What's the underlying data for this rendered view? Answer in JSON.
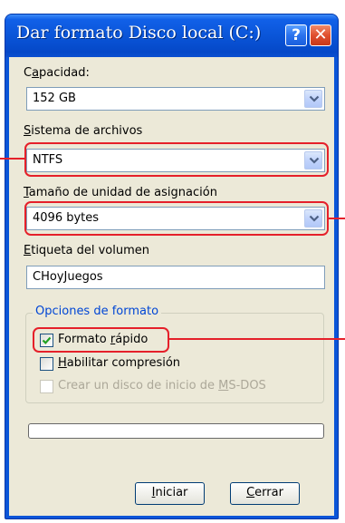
{
  "window": {
    "title": "Dar formato Disco local (C:)",
    "help_glyph": "?",
    "close_glyph": "✕"
  },
  "capacity": {
    "label_prefix": "C",
    "label_underlined": "a",
    "label_suffix": "pacidad:",
    "value": "152 GB"
  },
  "filesystem": {
    "label_underlined": "S",
    "label_suffix": "istema de archivos",
    "value": "NTFS"
  },
  "allocation": {
    "label_underlined": "T",
    "label_suffix": "amaño de unidad de asignación",
    "value": "4096 bytes"
  },
  "volume_label": {
    "label_underlined": "E",
    "label_suffix": "tiqueta del volumen",
    "value": "CHoyJuegos"
  },
  "format_options": {
    "legend_underlined": "O",
    "legend_suffix": "pciones de formato",
    "quick_format": {
      "label_prefix": "Formato ",
      "label_underlined": "r",
      "label_suffix": "ápido",
      "checked": true
    },
    "compression": {
      "label_underlined": "H",
      "label_suffix": "abilitar compresión",
      "checked": false
    },
    "msdos_disk": {
      "label_prefix": "Crear un disco de inicio de ",
      "label_underlined": "M",
      "label_suffix": "S-DOS",
      "checked": false,
      "disabled": true
    }
  },
  "progress": {
    "value": 0
  },
  "buttons": {
    "start": {
      "label_underlined": "I",
      "label_suffix": "niciar"
    },
    "close": {
      "label_underlined": "C",
      "label_suffix": "errar"
    }
  },
  "colors": {
    "title_bar": "#0a55d8",
    "dialog_face": "#ece9d8",
    "highlight": "#e5202a",
    "group_legend": "#0046d5"
  },
  "icons": {
    "dropdown": "chevron-down-icon",
    "check": "checkmark-icon"
  }
}
